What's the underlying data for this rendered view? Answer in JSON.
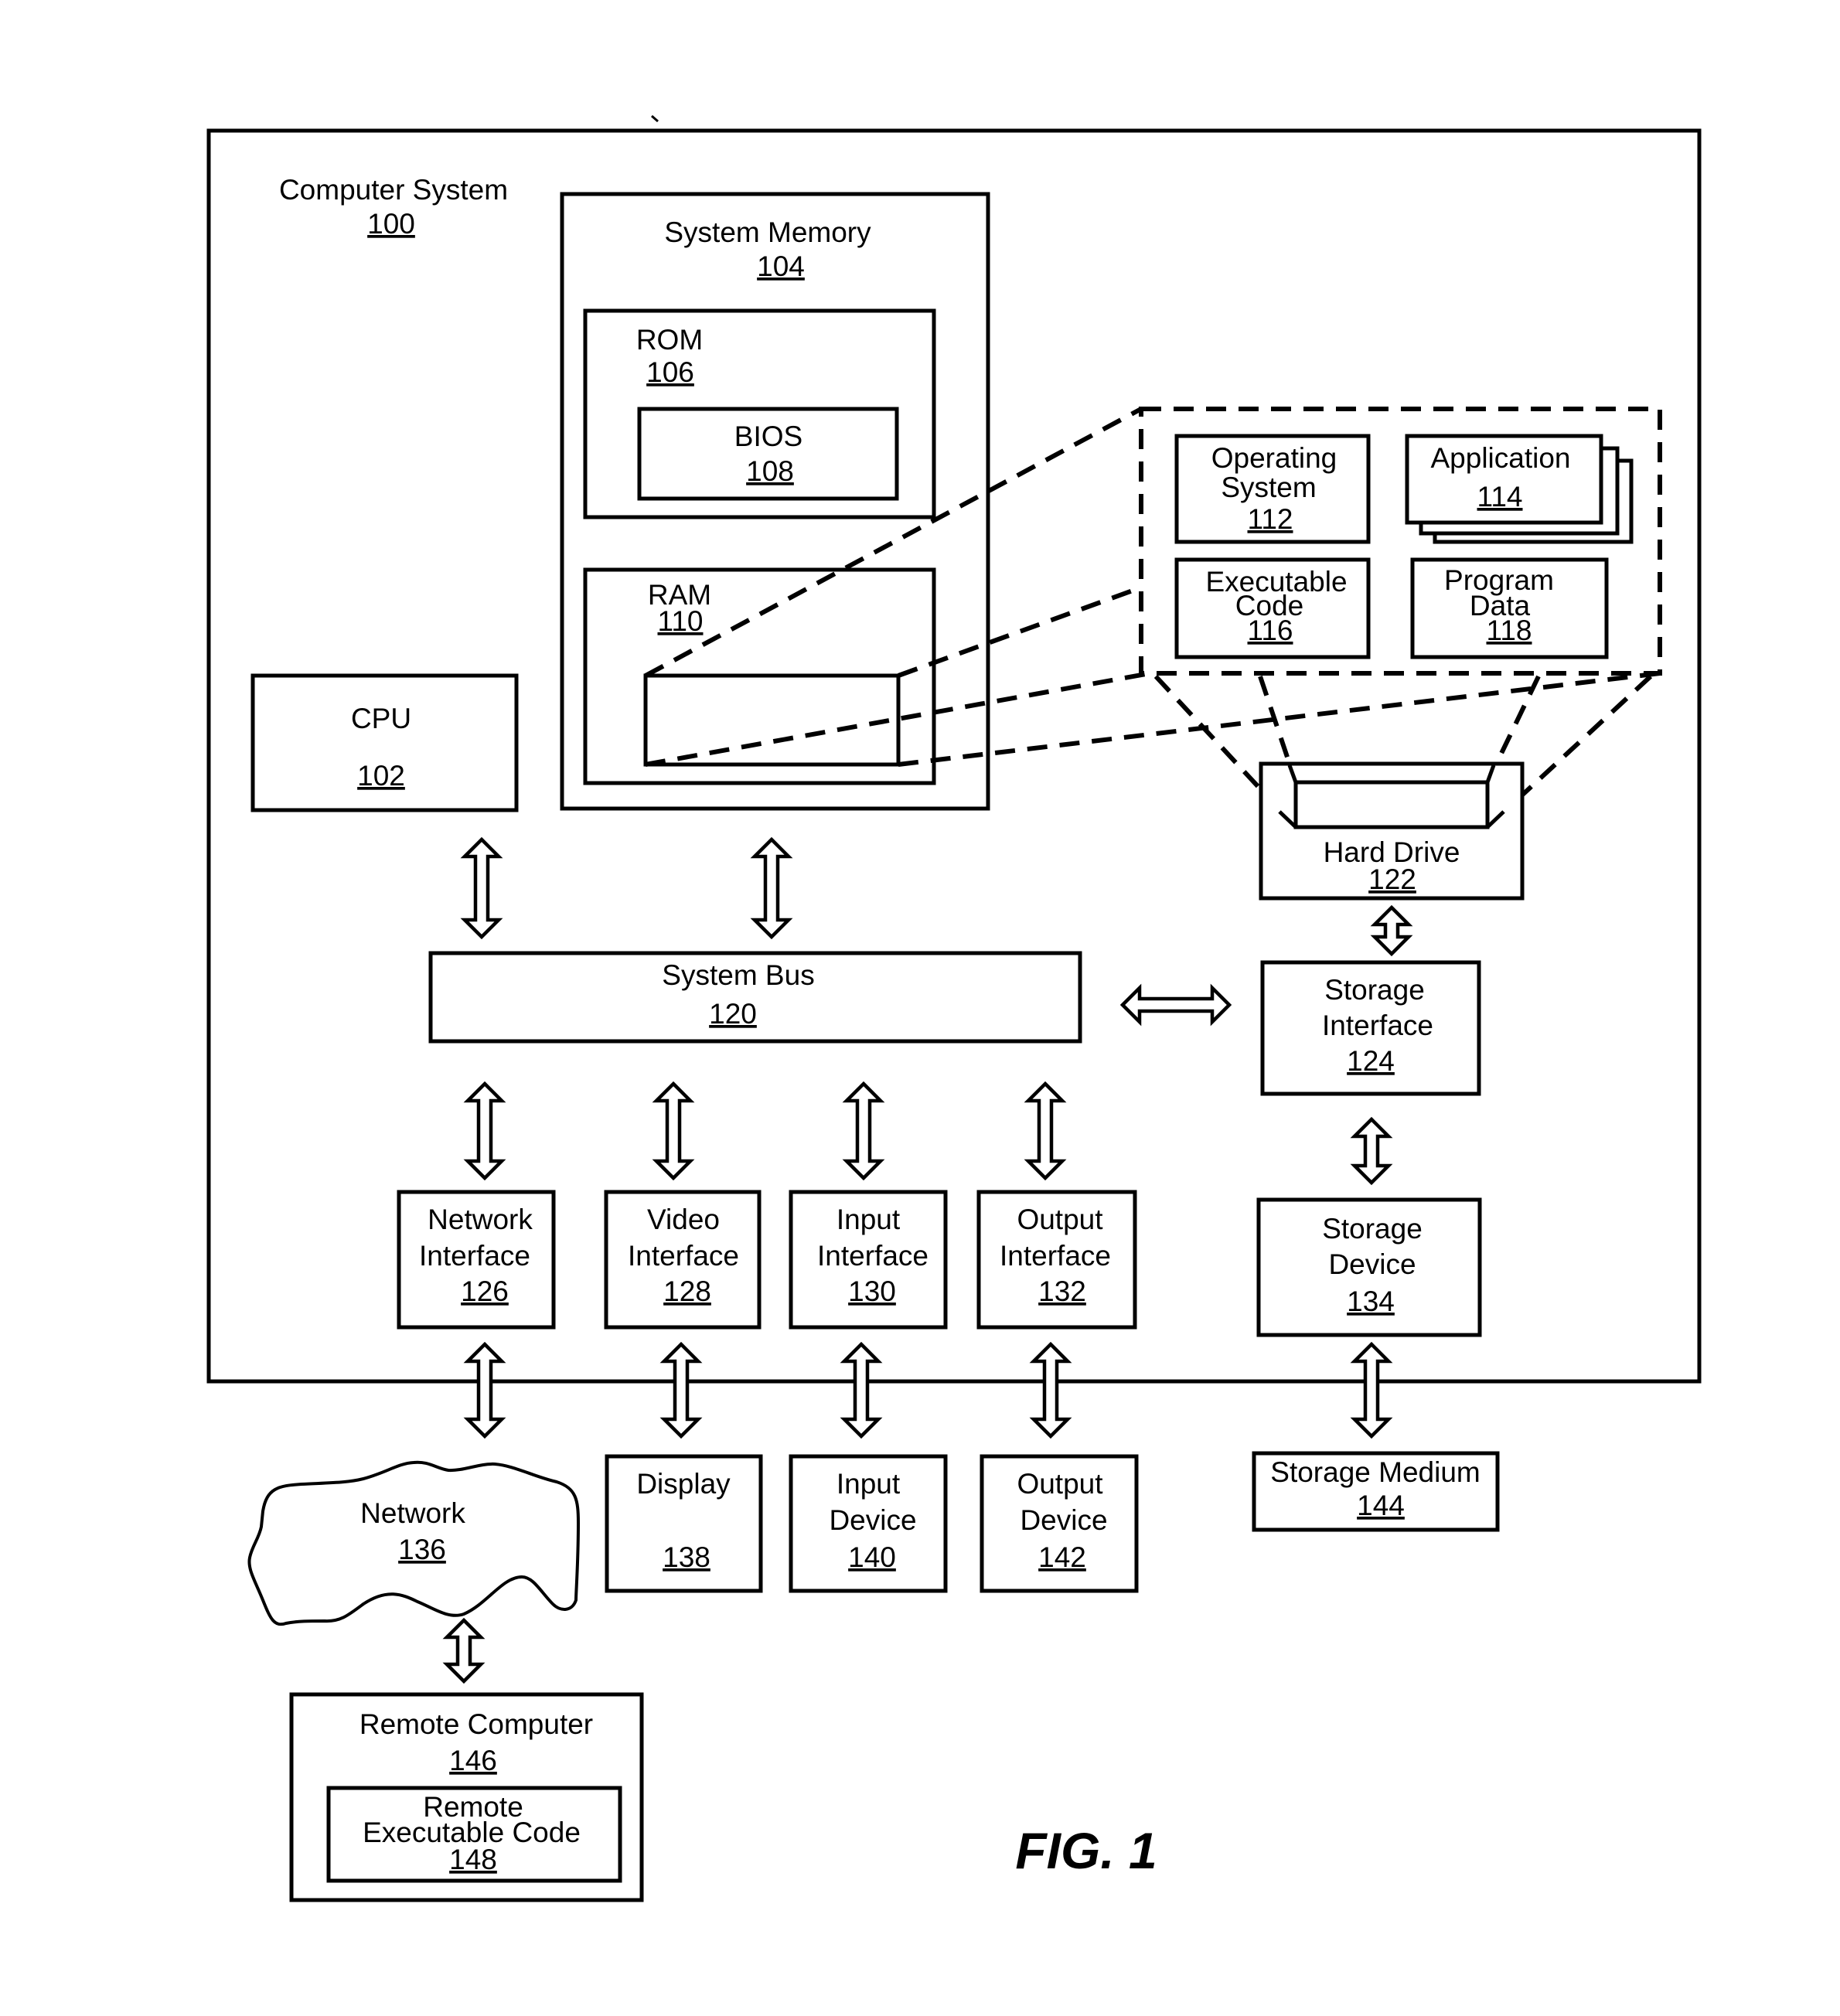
{
  "figure": {
    "caption": "FIG. 1"
  },
  "components": {
    "computer_system": {
      "label": "Computer System",
      "ref": "100"
    },
    "cpu": {
      "label": "CPU",
      "ref": "102"
    },
    "system_memory": {
      "label": "System Memory",
      "ref": "104"
    },
    "rom": {
      "label": "ROM",
      "ref": "106"
    },
    "bios": {
      "label": "BIOS",
      "ref": "108"
    },
    "ram": {
      "label": "RAM",
      "ref": "110"
    },
    "operating_system": {
      "label_lines": [
        "Operating",
        "System"
      ],
      "ref": "112"
    },
    "application": {
      "label": "Application",
      "ref": "114"
    },
    "executable_code": {
      "label_lines": [
        "Executable",
        "Code"
      ],
      "ref": "116"
    },
    "program_data": {
      "label_lines": [
        "Program",
        "Data"
      ],
      "ref": "118"
    },
    "system_bus": {
      "label": "System Bus",
      "ref": "120"
    },
    "hard_drive": {
      "label": "Hard Drive",
      "ref": "122"
    },
    "storage_interface": {
      "label_lines": [
        "Storage",
        "Interface"
      ],
      "ref": "124"
    },
    "network_interface": {
      "label_lines": [
        "Network",
        "Interface"
      ],
      "ref": "126"
    },
    "video_interface": {
      "label_lines": [
        "Video",
        "Interface"
      ],
      "ref": "128"
    },
    "input_interface": {
      "label_lines": [
        "Input",
        "Interface"
      ],
      "ref": "130"
    },
    "output_interface": {
      "label_lines": [
        "Output",
        "Interface"
      ],
      "ref": "132"
    },
    "storage_device": {
      "label_lines": [
        "Storage",
        "Device"
      ],
      "ref": "134"
    },
    "network": {
      "label": "Network",
      "ref": "136"
    },
    "display": {
      "label": "Display",
      "ref": "138"
    },
    "input_device": {
      "label_lines": [
        "Input",
        "Device"
      ],
      "ref": "140"
    },
    "output_device": {
      "label_lines": [
        "Output",
        "Device"
      ],
      "ref": "142"
    },
    "storage_medium": {
      "label": "Storage Medium",
      "ref": "144"
    },
    "remote_computer": {
      "label": "Remote Computer",
      "ref": "146"
    },
    "remote_executable_code": {
      "label_lines": [
        "Remote",
        "Executable Code"
      ],
      "ref": "148"
    }
  },
  "connections": [
    {
      "from": "cpu",
      "to": "system_bus",
      "type": "bidirectional"
    },
    {
      "from": "system_memory",
      "to": "system_bus",
      "type": "bidirectional"
    },
    {
      "from": "system_bus",
      "to": "storage_interface",
      "type": "bidirectional"
    },
    {
      "from": "hard_drive",
      "to": "storage_interface",
      "type": "bidirectional"
    },
    {
      "from": "storage_interface",
      "to": "storage_device",
      "type": "bidirectional"
    },
    {
      "from": "system_bus",
      "to": "network_interface",
      "type": "bidirectional"
    },
    {
      "from": "system_bus",
      "to": "video_interface",
      "type": "bidirectional"
    },
    {
      "from": "system_bus",
      "to": "input_interface",
      "type": "bidirectional"
    },
    {
      "from": "system_bus",
      "to": "output_interface",
      "type": "bidirectional"
    },
    {
      "from": "network_interface",
      "to": "network",
      "type": "bidirectional"
    },
    {
      "from": "video_interface",
      "to": "display",
      "type": "bidirectional"
    },
    {
      "from": "input_interface",
      "to": "input_device",
      "type": "bidirectional"
    },
    {
      "from": "output_interface",
      "to": "output_device",
      "type": "bidirectional"
    },
    {
      "from": "storage_device",
      "to": "storage_medium",
      "type": "bidirectional"
    },
    {
      "from": "network",
      "to": "remote_computer",
      "type": "bidirectional"
    }
  ]
}
